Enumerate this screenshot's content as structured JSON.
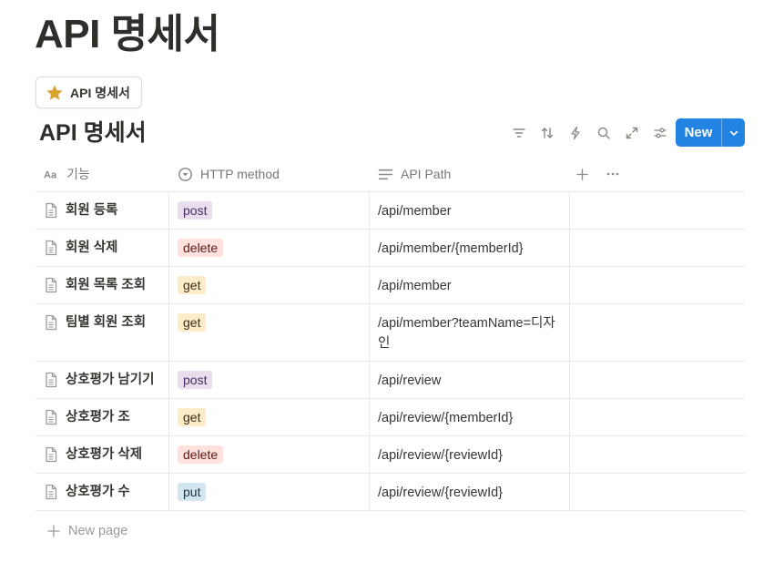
{
  "page": {
    "title": "API 명세서"
  },
  "view_tab": {
    "label": "API 명세서",
    "icon": "star-icon",
    "icon_color": "#d9a331"
  },
  "database": {
    "title": "API 명세서"
  },
  "toolbar": {
    "icons": [
      "filter-icon",
      "sort-icon",
      "automation-bolt-icon",
      "search-icon",
      "expand-icon",
      "settings-sliders-icon"
    ],
    "new_label": "New",
    "accent": "#2383e2"
  },
  "columns": [
    {
      "label": "기능",
      "icon": "title-aa-icon"
    },
    {
      "label": "HTTP method",
      "icon": "select-circle-icon"
    },
    {
      "label": "API Path",
      "icon": "text-lines-icon"
    }
  ],
  "rows": [
    {
      "name": "회원 등록",
      "method": "post",
      "path": "/api/member"
    },
    {
      "name": "회원 삭제",
      "method": "delete",
      "path": "/api/member/{memberId}"
    },
    {
      "name": "회원 목록 조회",
      "method": "get",
      "path": "/api/member"
    },
    {
      "name": "팀별 회원 조회",
      "method": "get",
      "path": "/api/member?teamName=디자인"
    },
    {
      "name": "상호평가 남기기",
      "method": "post",
      "path": "/api/review"
    },
    {
      "name": "상호평가 조",
      "method": "get",
      "path": "/api/review/{memberId}"
    },
    {
      "name": "상호평가 삭제",
      "method": "delete",
      "path": "/api/review/{reviewId}"
    },
    {
      "name": "상호평가 수",
      "method": "put",
      "path": "/api/review/{reviewId}"
    }
  ],
  "tag_colors": {
    "post": "#e8deee",
    "delete": "#ffe2dd",
    "get": "#fdecc8",
    "put": "#d3e5ef"
  },
  "new_page_label": "New page"
}
